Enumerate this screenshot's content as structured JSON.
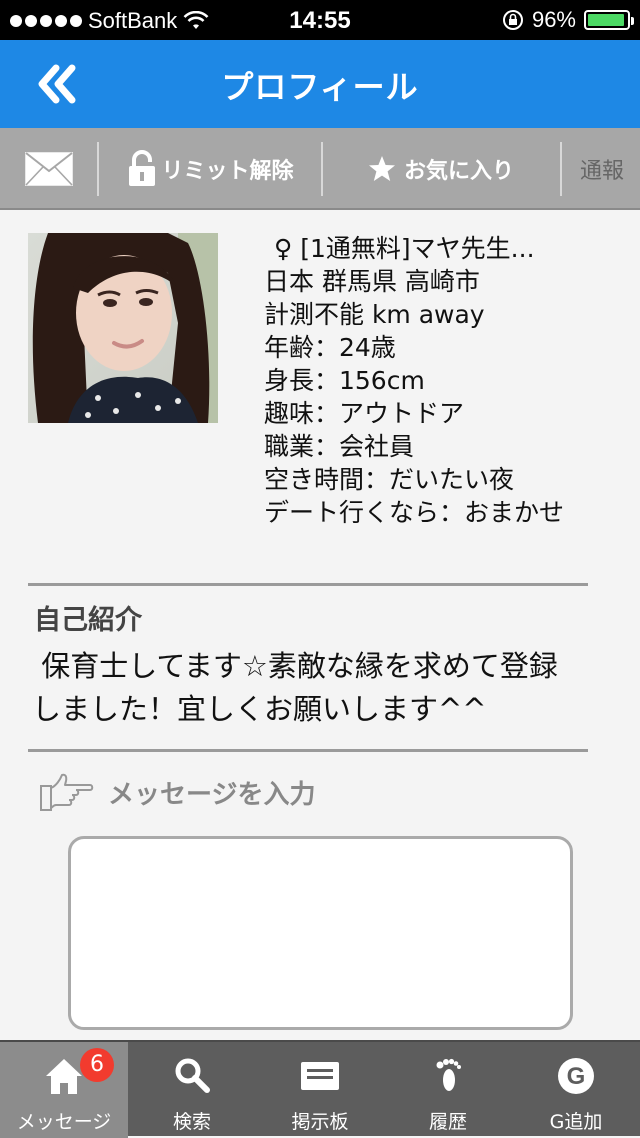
{
  "status_bar": {
    "carrier": "SoftBank",
    "time": "14:55",
    "battery": "96%",
    "battery_level": 0.96
  },
  "nav": {
    "title": "プロフィール",
    "back_icon": "double-chevron-left-icon"
  },
  "toolbar": {
    "mail_icon": "envelope-icon",
    "limit_label": "リミット解除",
    "favorite_label": "お気に入り",
    "report_label": "通報"
  },
  "profile": {
    "name_line": "♀ [1通無料]マヤ先生...",
    "location": "日本 群馬県 高崎市",
    "distance": "計測不能 km away",
    "age": "年齢：24歳",
    "height": "身長：156cm",
    "hobby": "趣味：アウトドア",
    "job": "職業：会社員",
    "free_time": "空き時間：だいたい夜",
    "date_pref": "デート行くなら：おまかせ"
  },
  "intro": {
    "title": "自己紹介",
    "line1": " 保育士してます☆素敵な縁を求めて登録",
    "line2": "しました！宜しくお願いします^^"
  },
  "message": {
    "label": "メッセージを入力",
    "value": ""
  },
  "tabs": [
    {
      "label": "メッセージ",
      "icon": "home-icon",
      "badge": "6"
    },
    {
      "label": "検索",
      "icon": "search-icon"
    },
    {
      "label": "掲示板",
      "icon": "board-icon"
    },
    {
      "label": "履歴",
      "icon": "footprint-icon"
    },
    {
      "label": "G追加",
      "icon": "g-icon"
    }
  ],
  "colors": {
    "nav_blue": "#1e88e5",
    "toolbar_gray": "#a7a7a7",
    "tabbar_gray": "#5d5d5d",
    "badge_red": "#f23b2e"
  }
}
